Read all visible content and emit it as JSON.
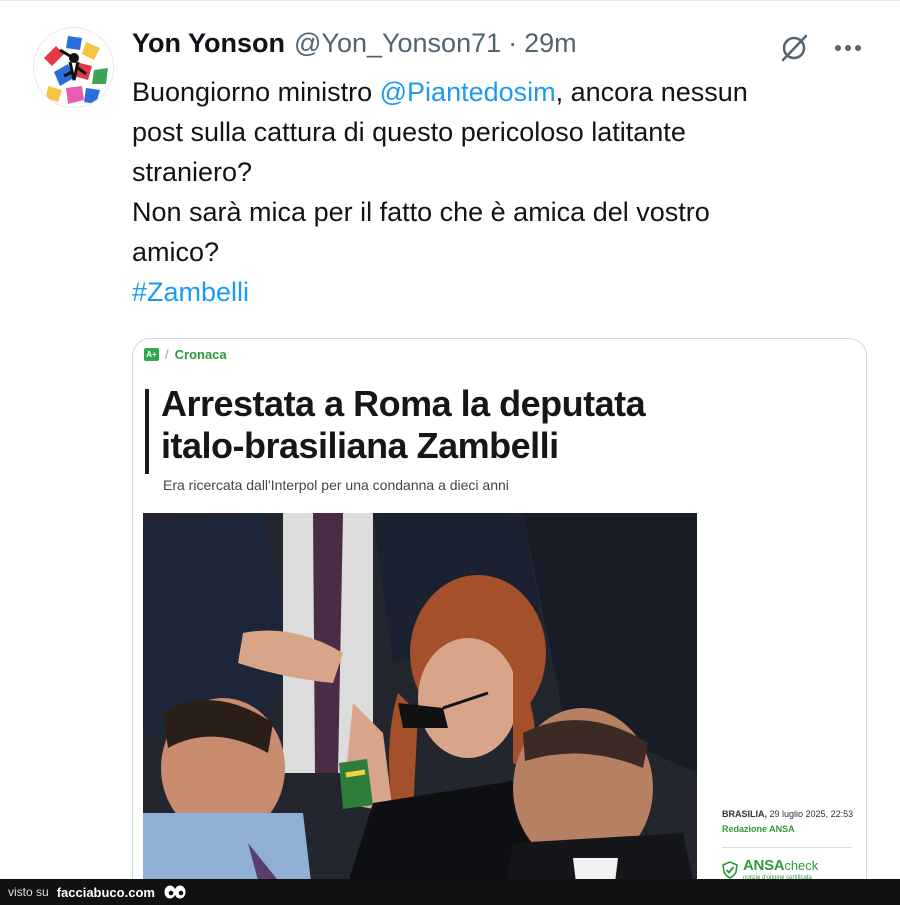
{
  "tweet": {
    "author": {
      "display_name": "Yon Yonson",
      "handle": "@Yon_Yonson71",
      "avatar_icon": "keith-haring-avatar"
    },
    "separator": "·",
    "time": "29m",
    "actions": {
      "grok_icon": "grok-icon",
      "more_icon": "more-options-icon"
    },
    "text": {
      "line1_before": "Buongiorno ministro ",
      "mention": "@Piantedosim",
      "line1_after": ", ancora nessun",
      "line2": "post sulla cattura di questo pericoloso latitante",
      "line3": "straniero?",
      "line4": "Non sarà mica per il fatto che è amica del vostro",
      "line5": "amico?",
      "hashtag": "#Zambelli"
    },
    "colors": {
      "link": "#1d9bf0",
      "text": "#0f1419",
      "secondary": "#536471"
    }
  },
  "card": {
    "section_logo": "A+",
    "section_slash": "/",
    "section": "Cronaca",
    "headline_line1": "Arrestata a Roma la deputata",
    "headline_line2": "italo-brasiliana Zambelli",
    "subtitle": "Era ricercata dall'Interpol per una condanna a dieci anni",
    "photo_description_icon": "news-photo",
    "meta": {
      "place": "BRASILIA,",
      "date": "29 luglio 2025, 22:53",
      "author": "Redazione ANSA"
    },
    "badge": {
      "brand": "ANSA",
      "suffix": "check",
      "tagline": "notizie d'origine certificata"
    },
    "accent_color": "#2e9a3a"
  },
  "footer": {
    "visto_su": "visto su",
    "site": "facciabuco.com"
  }
}
